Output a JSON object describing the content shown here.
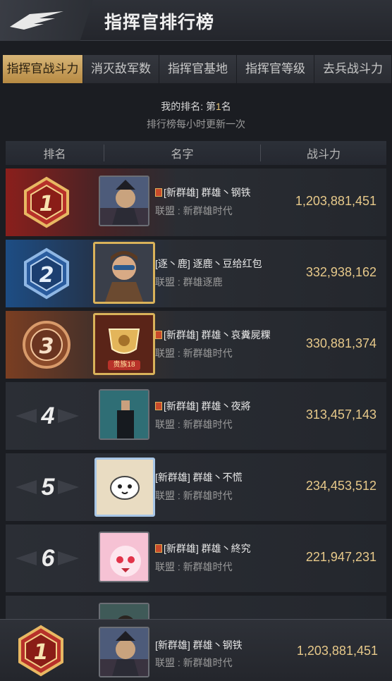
{
  "header": {
    "title": "指挥官排行榜",
    "back_icon": "wing-logo-icon"
  },
  "tabs": [
    {
      "label": "指挥官战斗力",
      "active": true
    },
    {
      "label": "消灭敌军数",
      "active": false
    },
    {
      "label": "指挥官基地",
      "active": false
    },
    {
      "label": "指挥官等级",
      "active": false
    },
    {
      "label": "去兵战斗力",
      "active": false
    }
  ],
  "my_rank": {
    "prefix": "我的排名: 第",
    "number": "1",
    "suffix": "名"
  },
  "update_note": "排行榜每小时更新一次",
  "columns": {
    "rank": "排名",
    "name": "名字",
    "power": "战斗力"
  },
  "rows": [
    {
      "rank": "1",
      "name": "[新群雄] 群雄丶钢铁",
      "alliance": "联盟 : 新群雄时代",
      "power": "1,203,881,451",
      "flag": true
    },
    {
      "rank": "2",
      "name": "[逐丶鹿] 逐鹿丶豆给红包",
      "alliance": "联盟 : 群雄逐鹿",
      "power": "332,938,162",
      "flag": false
    },
    {
      "rank": "3",
      "name": "[新群雄] 群雄丶哀糞屍粿",
      "alliance": "联盟 : 新群雄时代",
      "power": "330,881,374",
      "flag": true,
      "frame_text": "贵族18"
    },
    {
      "rank": "4",
      "name": "[新群雄] 群雄丶夜將",
      "alliance": "联盟 : 新群雄时代",
      "power": "313,457,143",
      "flag": true
    },
    {
      "rank": "5",
      "name": "[新群雄] 群雄丶不慌",
      "alliance": "联盟 : 新群雄时代",
      "power": "234,453,512",
      "flag": false
    },
    {
      "rank": "6",
      "name": "[新群雄] 群雄丶終究",
      "alliance": "联盟 : 新群雄时代",
      "power": "221,947,231",
      "flag": true
    }
  ],
  "footer": {
    "rank": "1",
    "name": "[新群雄] 群雄丶钢铁",
    "alliance": "联盟 : 新群雄时代",
    "power": "1,203,881,451"
  }
}
